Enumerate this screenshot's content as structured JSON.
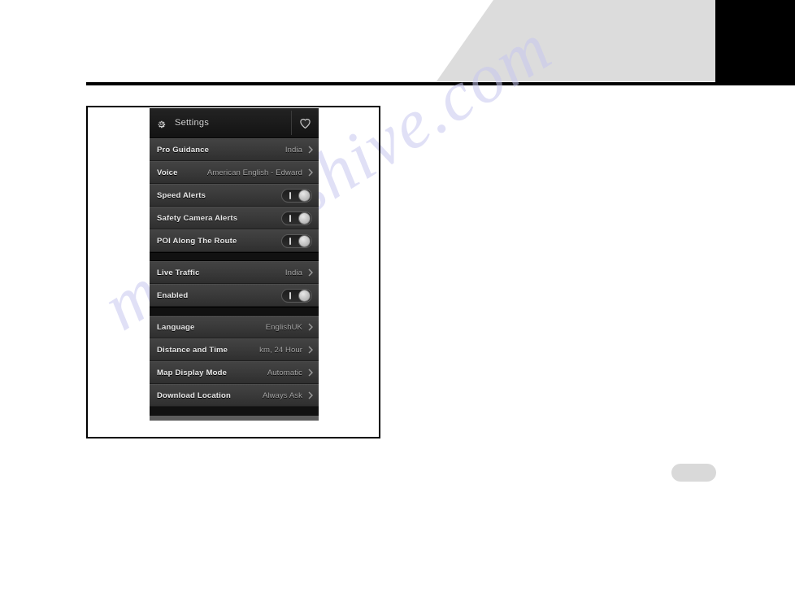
{
  "panel": {
    "header": {
      "title": "Settings",
      "gear_icon": "gear-icon",
      "favorite_icon": "heart-icon"
    },
    "groups": [
      {
        "rows": [
          {
            "label": "Pro Guidance",
            "value": "India",
            "control": "chevron"
          },
          {
            "label": "Voice",
            "value": "American English - Edward",
            "control": "chevron"
          },
          {
            "label": "Speed Alerts",
            "value": "",
            "control": "toggle",
            "toggle_state": "on"
          },
          {
            "label": "Safety Camera Alerts",
            "value": "",
            "control": "toggle",
            "toggle_state": "on"
          },
          {
            "label": "POI Along The Route",
            "value": "",
            "control": "toggle",
            "toggle_state": "on"
          }
        ]
      },
      {
        "rows": [
          {
            "label": "Live Traffic",
            "value": "India",
            "control": "chevron"
          },
          {
            "label": "Enabled",
            "value": "",
            "control": "toggle",
            "toggle_state": "on"
          }
        ]
      },
      {
        "rows": [
          {
            "label": "Language",
            "value": "EnglishUK",
            "control": "chevron"
          },
          {
            "label": "Distance and Time",
            "value": "km, 24 Hour",
            "control": "chevron"
          },
          {
            "label": "Map Display Mode",
            "value": "Automatic",
            "control": "chevron"
          },
          {
            "label": "Download Location",
            "value": "Always Ask",
            "control": "chevron"
          }
        ]
      }
    ]
  },
  "page": {
    "watermark": "manualshive.com",
    "colors": {
      "banner_gray": "#dcdcdc",
      "corner_black": "#000000",
      "panel_row": "#3a3a3a",
      "panel_header": "#151515",
      "label_text": "#e8e8e8",
      "value_text": "#a6a6a6",
      "pill_gray": "#d9d9d9"
    }
  }
}
